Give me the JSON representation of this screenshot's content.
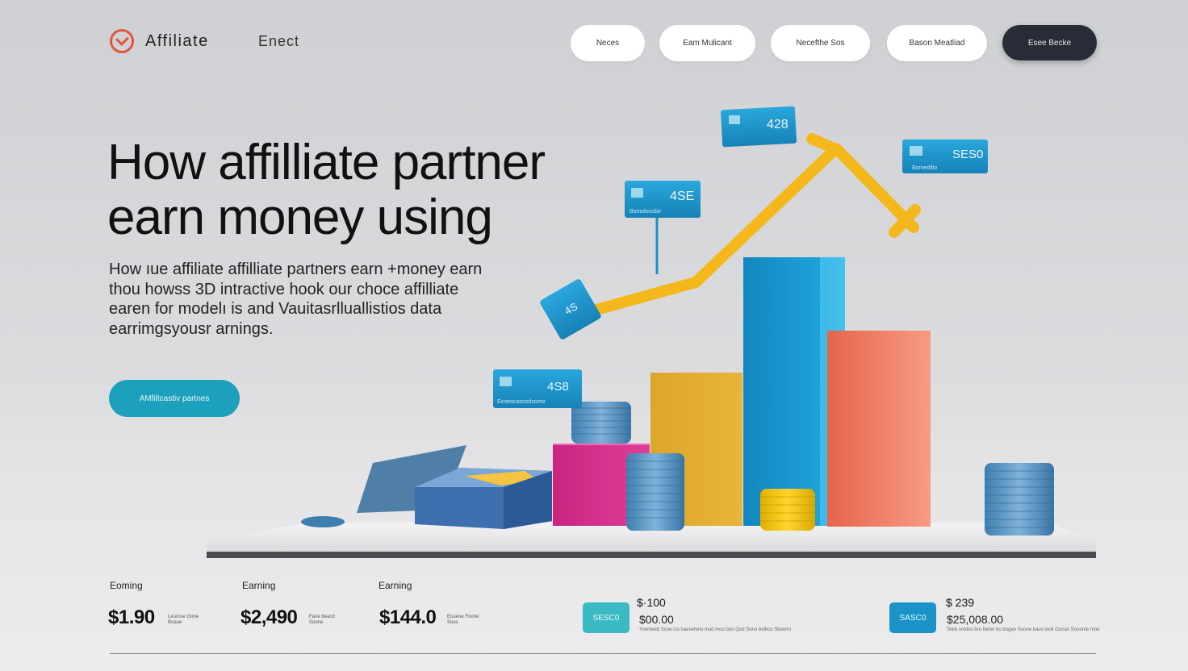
{
  "header": {
    "brand": "Affiliate",
    "brand_secondary": "Enect",
    "nav": [
      "Neces",
      "Eam Mulicant",
      "Necefthe Sos",
      "Bason Meatliad"
    ],
    "nav_cta": "Esee Becke"
  },
  "hero": {
    "title_line1": "How  affilliate partner",
    "title_line2": "earn  money using",
    "body_lines": [
      "How ıue affiliate affilliate partners earn +money earn",
      "thou howss 3D intractive hook our choce affilliate",
      "earen for modelı is and Vauitasrlluallistios data",
      "earrimgsyousr arnings."
    ],
    "cta": "AMfiltcastiv partnes"
  },
  "scene": {
    "tags": [
      {
        "value": "428",
        "sub": ""
      },
      {
        "value": "SES0",
        "sub": "Bomedilto"
      },
      {
        "value": "4SE",
        "sub": "Bomolocobo"
      },
      {
        "value": "4S",
        "sub": ""
      },
      {
        "value": "4S8",
        "sub": "Ecoeocasoodsomo"
      }
    ],
    "colors": {
      "blue": "#1c9bd3",
      "yellow": "#f5b81c",
      "coral": "#ef7456",
      "mustard": "#e3ad2c",
      "magenta": "#d7318d"
    }
  },
  "stats": [
    {
      "label": "Eoming",
      "value": "$1.90",
      "sub": "Leurose Gone Boaue"
    },
    {
      "label": "Earning",
      "value": "$2,490",
      "sub": "Fane beacd Soone"
    },
    {
      "label": "Earning",
      "value": "$144.0",
      "sub": "Eoueoe Foone Sous"
    }
  ],
  "payouts": [
    {
      "chip": "SESC0",
      "title": "$·100",
      "amount": "$00.00",
      "line": "Yoomeeb Scoe Uo baesehelo mod moo boo Qod Sono bolbos Sboorm"
    },
    {
      "chip": "SASC0",
      "title": "$ 239",
      "amount": "$25,008.00",
      "line": "Teeb ooldoo bro belon bo bogan Soooe baos loolt Gonan Sooonte moe"
    }
  ]
}
